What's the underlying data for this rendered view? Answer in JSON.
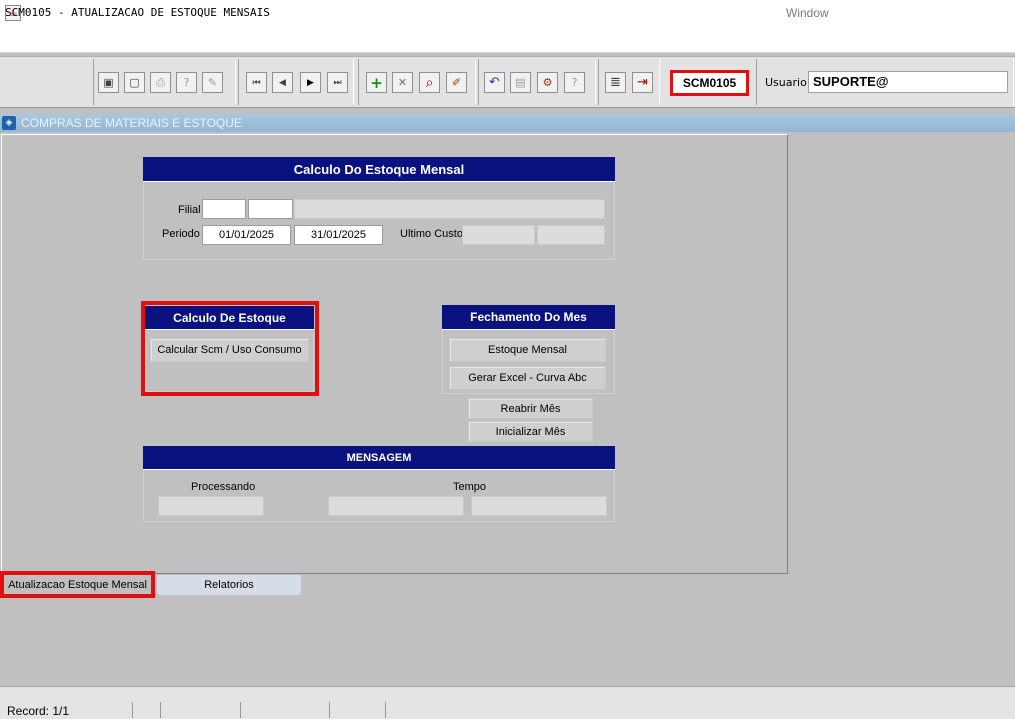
{
  "window": {
    "title": "SCM0105 - ATUALIZACAO DE ESTOQUE MENSAIS",
    "menu_window": "Window"
  },
  "toolbar": {
    "screen_code": "SCM0105",
    "user_label": "Usuario",
    "user_value": "SUPORTE@",
    "buttons": [
      {
        "name": "save-icon",
        "glyph": "▣"
      },
      {
        "name": "screen-icon",
        "glyph": "▢"
      },
      {
        "name": "print-icon",
        "glyph": "⎙"
      },
      {
        "name": "query-help-icon",
        "glyph": "?"
      },
      {
        "name": "edit-help-icon",
        "glyph": "✎"
      },
      {
        "name": "first-record-icon",
        "glyph": "⏮"
      },
      {
        "name": "previous-record-icon",
        "glyph": "◀"
      },
      {
        "name": "next-record-icon",
        "glyph": "▶"
      },
      {
        "name": "last-record-icon",
        "glyph": "⏭"
      },
      {
        "name": "insert-record-icon",
        "glyph": "+"
      },
      {
        "name": "delete-record-icon",
        "glyph": "✕"
      },
      {
        "name": "search-icon",
        "glyph": "⌕"
      },
      {
        "name": "clear-icon",
        "glyph": "✐"
      },
      {
        "name": "undo-icon",
        "glyph": "↶"
      },
      {
        "name": "clipboard-icon",
        "glyph": "▤"
      },
      {
        "name": "settings-icon",
        "glyph": "⚙"
      },
      {
        "name": "help-icon",
        "glyph": "?"
      },
      {
        "name": "menu-icon",
        "glyph": "≣"
      },
      {
        "name": "exit-icon",
        "glyph": "⇥"
      }
    ]
  },
  "module": {
    "title": "COMPRAS DE MATERIAIS E ESTOQUE"
  },
  "calc_frame": {
    "title": "Calculo Do Estoque Mensal",
    "filial_label": "Filial",
    "periodo_label": "Periodo",
    "periodo_start": "01/01/2025",
    "periodo_end": "31/01/2025",
    "ultimo_custo_label": "Ultimo Custo"
  },
  "estoque_frame": {
    "title": "Calculo De Estoque",
    "calc_button": "Calcular Scm / Uso Consumo"
  },
  "fechamento_frame": {
    "title": "Fechamento Do Mes",
    "estoque_mensal_button": "Estoque Mensal",
    "excel_button": "Gerar Excel - Curva Abc",
    "reabrir_button": "Reabrir Mês",
    "inicializar_button": "Inicializar Mês"
  },
  "mensagem_frame": {
    "title": "MENSAGEM",
    "processando_label": "Processando",
    "tempo_label": "Tempo"
  },
  "tabs": [
    {
      "label": "Atualizacao Estoque Mensal"
    },
    {
      "label": "Relatorios"
    }
  ],
  "status": {
    "record": "Record: 1/1"
  },
  "colors": {
    "frame_title_bg": "#0a1280",
    "highlight": "#e01010",
    "module_bar": "#9dbfdc"
  }
}
